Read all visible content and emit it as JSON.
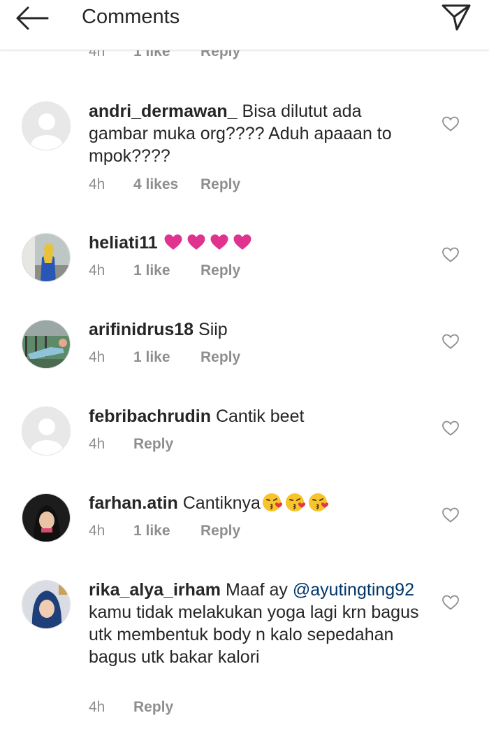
{
  "header": {
    "title": "Comments",
    "back_icon": "back-arrow-icon",
    "send_icon": "paper-plane-icon"
  },
  "colors": {
    "text": "#262626",
    "meta": "#8e8e8e",
    "mention": "#003569",
    "emoji_heart": "#e0338f"
  },
  "partial_comment": {
    "time": "4h",
    "likes": "1 like",
    "reply": "Reply"
  },
  "comments": [
    {
      "username": "andri_dermawan_",
      "text": "Bisa dilutut ada gambar muka org???? Aduh apaaan to mpok????",
      "time": "4h",
      "likes": "4 likes",
      "reply": "Reply",
      "avatar": "default-avatar"
    },
    {
      "username": "heliati11",
      "text": "",
      "emoji": "heart-emoji x4",
      "time": "4h",
      "likes": "1 like",
      "reply": "Reply",
      "avatar": "photo-avatar"
    },
    {
      "username": "arifinidrus18",
      "text": "Siip",
      "time": "4h",
      "likes": "1 like",
      "reply": "Reply",
      "avatar": "photo-avatar"
    },
    {
      "username": "febribachrudin",
      "text": "Cantik beet",
      "time": "4h",
      "likes": "",
      "reply": "Reply",
      "avatar": "default-avatar"
    },
    {
      "username": "farhan.atin",
      "text": "Cantiknya",
      "emoji": "kissing-face-emoji x3",
      "time": "4h",
      "likes": "1 like",
      "reply": "Reply",
      "avatar": "photo-avatar"
    },
    {
      "username": "rika_alya_irham",
      "text_before": "Maaf ay",
      "mention": "@ayutingting92",
      "text_after": "kamu tidak melakukan yoga lagi krn bagus utk membentuk body n kalo sepedahan bagus utk bakar kalori",
      "time": "4h",
      "likes": "",
      "reply": "Reply",
      "avatar": "photo-avatar"
    }
  ]
}
